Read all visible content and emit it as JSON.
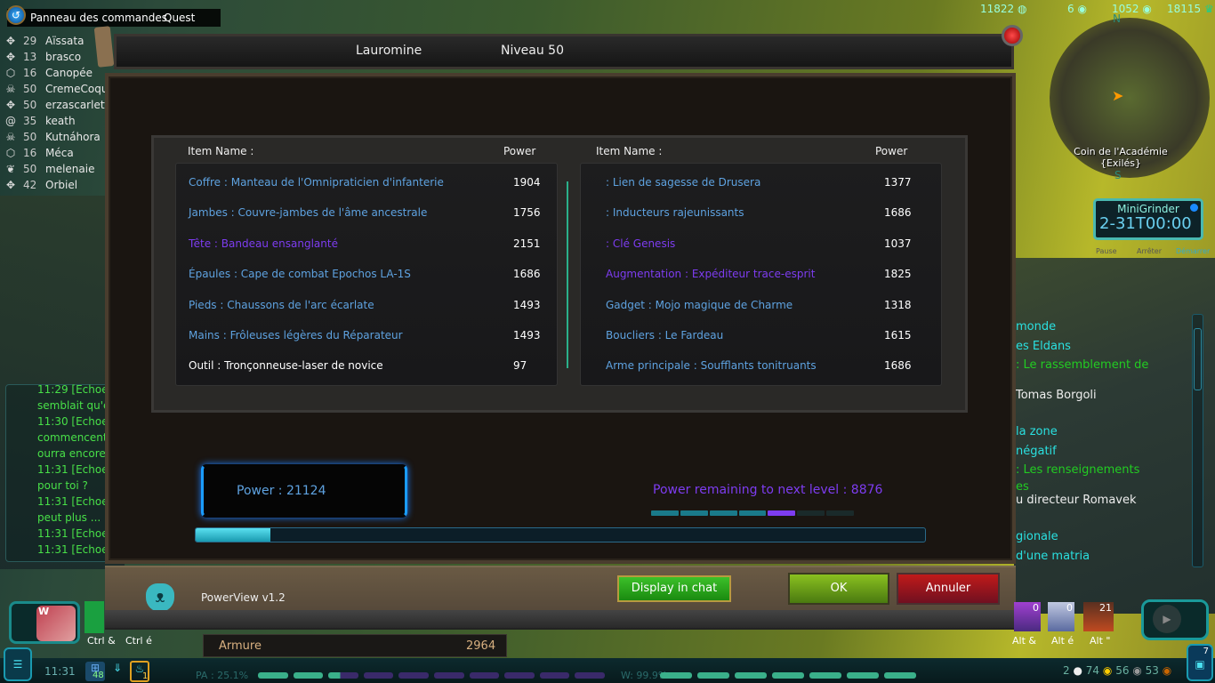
{
  "topbar": {
    "title": "Panneau des commandes",
    "next_tab": "Quest"
  },
  "friends": [
    {
      "icon": "crosshair-icon",
      "level": "29",
      "name": "Aïssata"
    },
    {
      "icon": "crosshair-icon",
      "level": "13",
      "name": "brasco"
    },
    {
      "icon": "shield-icon",
      "level": "16",
      "name": "Canopée"
    },
    {
      "icon": "skull-icon",
      "level": "50",
      "name": "CremeCoqu"
    },
    {
      "icon": "crosshair-icon",
      "level": "50",
      "name": "erzascarlett"
    },
    {
      "icon": "spiral-icon",
      "level": "35",
      "name": "keath"
    },
    {
      "icon": "skull-icon",
      "level": "50",
      "name": "Kutnáhora"
    },
    {
      "icon": "shield-icon",
      "level": "16",
      "name": "Méca"
    },
    {
      "icon": "feather-icon",
      "level": "50",
      "name": "melenaie"
    },
    {
      "icon": "crosshair-icon",
      "level": "42",
      "name": "Orbiel"
    }
  ],
  "chat": [
    "11:29 [Echoe",
    "semblait qu'e",
    "11:30 [Echoe",
    "commencent",
    "ourra encore",
    "11:31 [Echoe",
    "pour toi ?",
    "11:31 [Echoe",
    "peut plus ... \"",
    "11:31 [Echoe",
    "11:31 [Echoe"
  ],
  "currencies_top": [
    "11822",
    "6",
    "1052",
    "18115"
  ],
  "minimap": {
    "zone": "Coin de l'Académie",
    "faction": "{Exilés}",
    "north": "N",
    "south": "S"
  },
  "minigrinder": {
    "title": "MiniGrinder",
    "time": "2-31T00:00",
    "pause": "Pause",
    "stop": "Arrêter",
    "start": "Démarrer"
  },
  "quests": [
    {
      "text": "monde",
      "color": "cyan"
    },
    {
      "text": "es Eldans",
      "color": "cyan"
    },
    {
      "text": ": Le rassemblement de",
      "color": "green"
    },
    {
      "text": "Tomas Borgoli",
      "color": "white"
    },
    {
      "text": "la zone",
      "color": "cyan"
    },
    {
      "text": "négatif",
      "color": "cyan"
    },
    {
      "text": ": Les renseignements",
      "color": "green"
    },
    {
      "text": "es",
      "color": "green"
    },
    {
      "text": "u directeur Romavek",
      "color": "white"
    },
    {
      "text": "gionale",
      "color": "cyan"
    },
    {
      "text": "d'une matria",
      "color": "cyan"
    }
  ],
  "window": {
    "character": "Lauromine",
    "level": "Niveau 50",
    "col_item": "Item Name :",
    "col_power": "Power",
    "left_items": [
      {
        "name": "Coffre : Manteau de l'Omnipraticien d'infanterie",
        "power": "1904",
        "quality": "blue"
      },
      {
        "name": "Jambes : Couvre-jambes de l'âme ancestrale",
        "power": "1756",
        "quality": "blue"
      },
      {
        "name": "Tête : Bandeau ensanglanté",
        "power": "2151",
        "quality": "purple"
      },
      {
        "name": "Épaules : Cape de combat Epochos LA-1S",
        "power": "1686",
        "quality": "blue"
      },
      {
        "name": "Pieds : Chaussons de l'arc écarlate",
        "power": "1493",
        "quality": "blue"
      },
      {
        "name": "Mains : Frôleuses légères du Réparateur",
        "power": "1493",
        "quality": "blue"
      },
      {
        "name": "Outil : Tronçonneuse-laser de novice",
        "power": "97",
        "quality": "white"
      }
    ],
    "right_items": [
      {
        "name": " : Lien de sagesse de Drusera",
        "power": "1377",
        "quality": "blue"
      },
      {
        "name": " : Inducteurs rajeunissants",
        "power": "1686",
        "quality": "blue"
      },
      {
        "name": " : Clé Genesis",
        "power": "1037",
        "quality": "purple"
      },
      {
        "name": "Augmentation : Expéditeur trace-esprit",
        "power": "1825",
        "quality": "purple"
      },
      {
        "name": "Gadget : Mojo magique de Charme",
        "power": "1318",
        "quality": "blue"
      },
      {
        "name": "Boucliers : Le Fardeau",
        "power": "1615",
        "quality": "blue"
      },
      {
        "name": "Arme principale : Soufflants tonitruants",
        "power": "1686",
        "quality": "blue"
      }
    ],
    "total_power": "Power : 21124",
    "remaining": "Power remaining to next level : 8876",
    "tier_segments": {
      "total": 7,
      "completed": 4,
      "current": 5
    },
    "progress_percent": 10.3,
    "addon": "PowerView v1.2",
    "display_chat": "Display in chat",
    "ok": "OK",
    "cancel": "Annuler"
  },
  "colors": {
    "blue": "#5ea2e0",
    "purple": "#7d3cf0",
    "white": "#ffffff"
  },
  "armor": {
    "label": "Armure",
    "value": "2964"
  },
  "hotbar": {
    "w_key": "W",
    "ctrl1": "Ctrl &",
    "ctrl2": "Ctrl é",
    "alt1": "Alt &",
    "alt2": "Alt é",
    "alt3": "Alt \"",
    "count1": "0",
    "count2": "0",
    "count3": "21"
  },
  "bottom": {
    "time": "11:31",
    "gift_count": "48",
    "flame_count": "1",
    "pa": "PA : 25.1%",
    "w": "W: 99.9%",
    "currencies": [
      "2",
      "74",
      "56",
      "53"
    ],
    "bag_count": "7"
  }
}
